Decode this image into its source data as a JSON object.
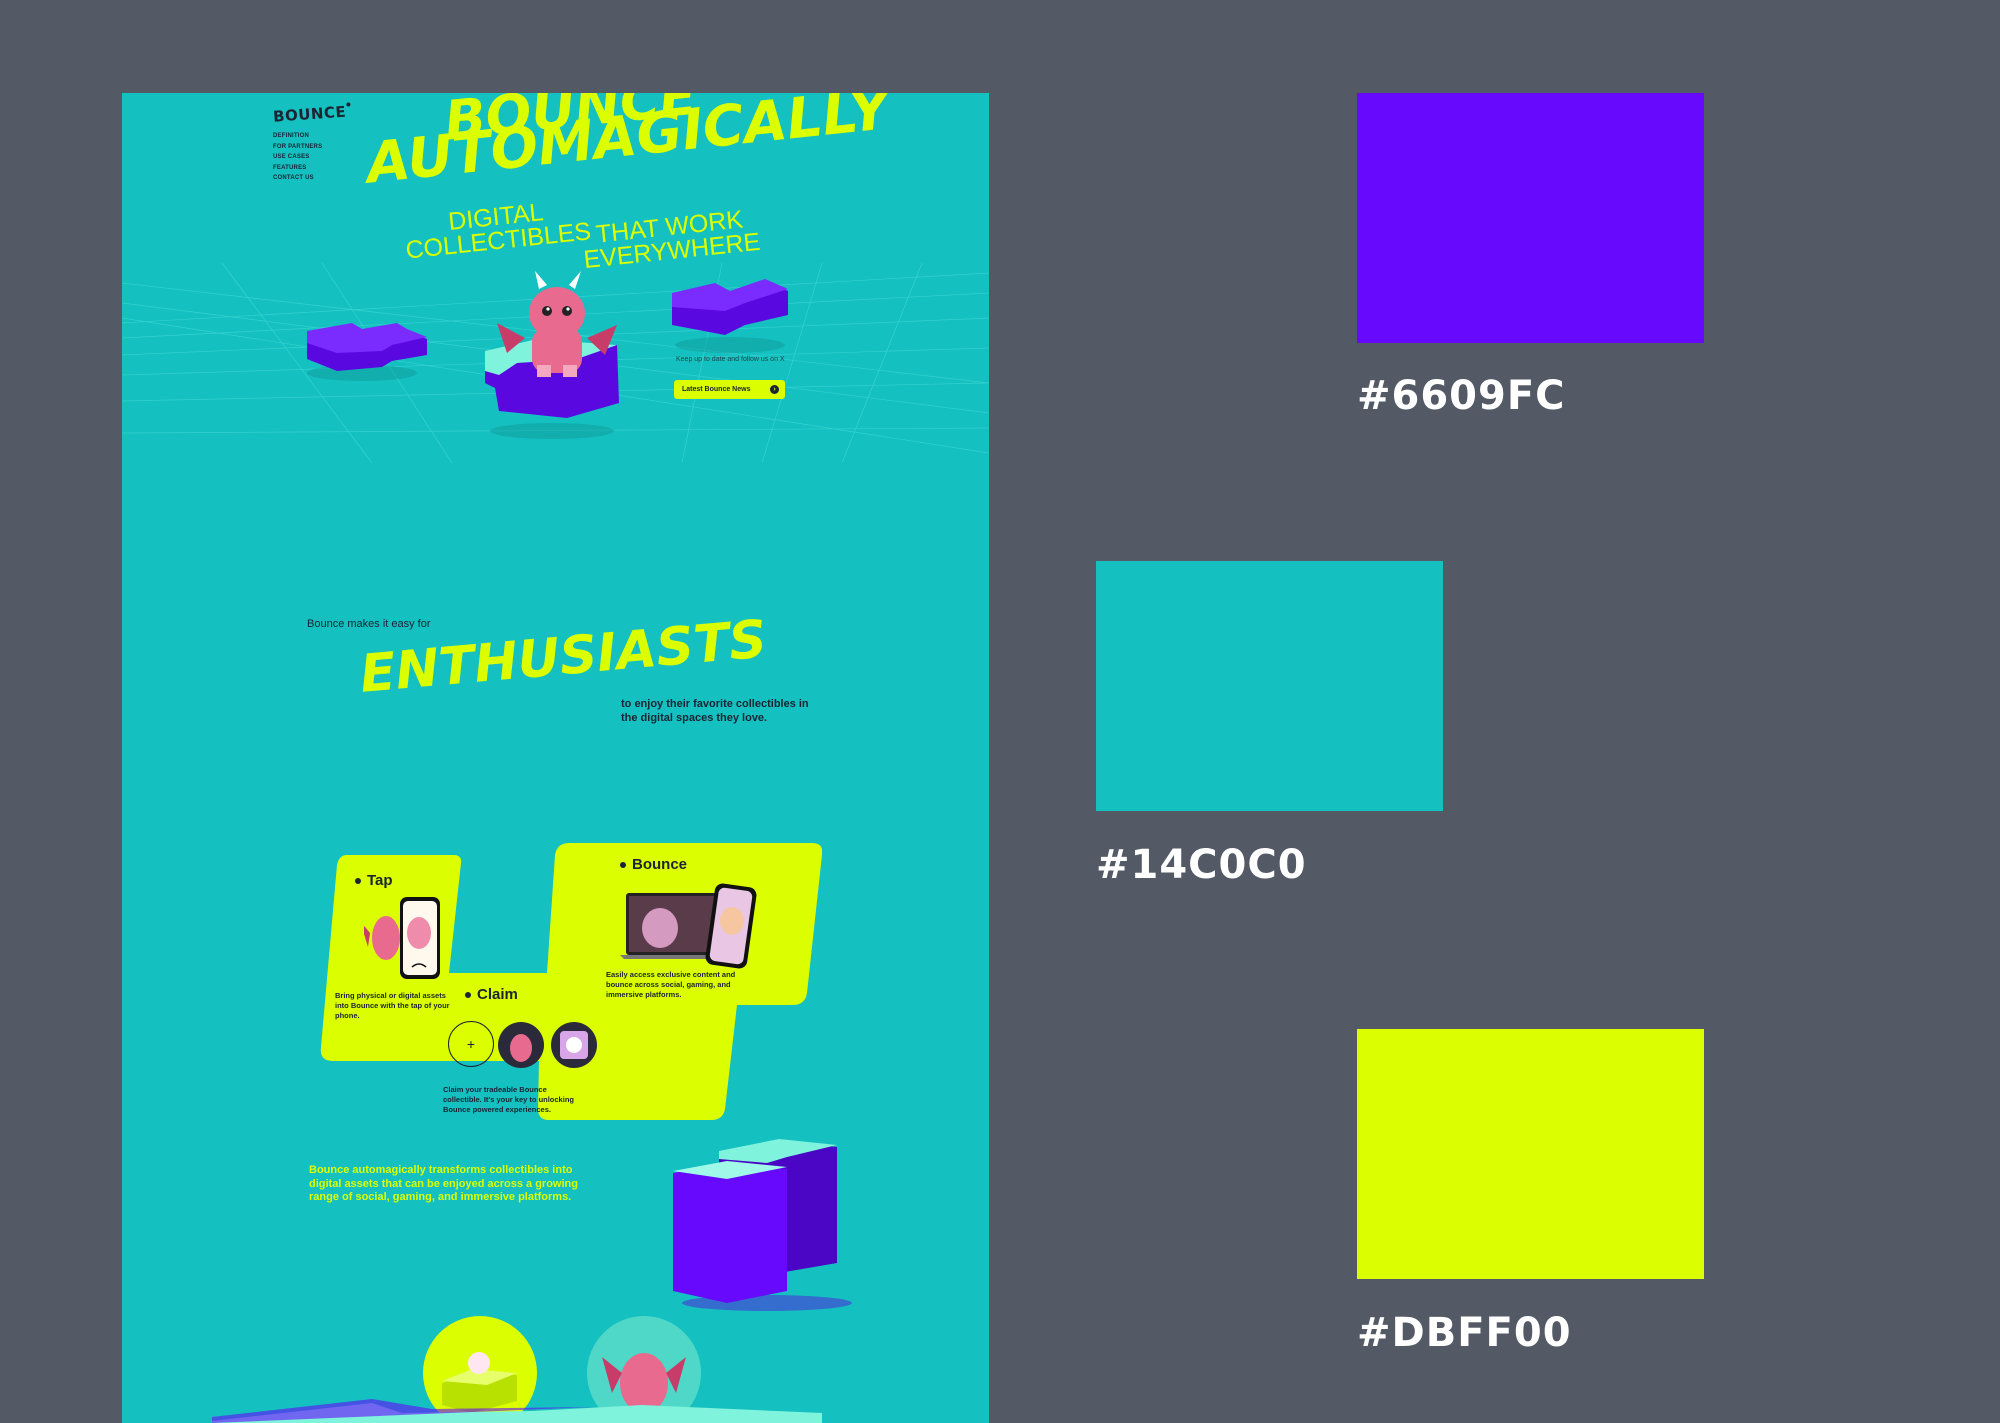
{
  "site": {
    "logo": "BOUNCE",
    "nav": [
      "DEFINITION",
      "FOR PARTNERS",
      "USE CASES",
      "FEATURES",
      "CONTACT US"
    ],
    "hero": {
      "line1": "BOUNCE",
      "line2": "AUTOMAGICALLY",
      "sub_left_1": "DIGITAL",
      "sub_left_2": "COLLECTIBLES",
      "sub_right_1": "THAT WORK",
      "sub_right_2": "EVERYWHERE"
    },
    "news": {
      "text": "Keep up to date and follow us on X",
      "button": "Latest Bounce News"
    },
    "audience": {
      "intro": "Bounce makes it easy for",
      "headline": "ENTHUSIASTS",
      "outro": "to enjoy their favorite collectibles in the digital spaces they love."
    },
    "features": {
      "tap": {
        "title": "Tap",
        "desc": "Bring physical or digital assets into Bounce with the tap of your phone."
      },
      "claim": {
        "title": "Claim",
        "add_symbol": "+",
        "desc": "Claim your tradeable Bounce collectible. It's your key to unlocking Bounce powered experiences."
      },
      "bounce": {
        "title": "Bounce",
        "desc": "Easily access exclusive content and bounce across social, gaming, and immersive platforms."
      }
    },
    "transform_text": "Bounce automagically transforms collectibles into digital assets that can be enjoyed across a growing range of social, gaming, and immersive platforms."
  },
  "palette": [
    {
      "label": "#6609FC",
      "color": "#6609FC"
    },
    {
      "label": "#14C0C0",
      "color": "#14C0C0"
    },
    {
      "label": "#DBFF00",
      "color": "#DBFF00"
    }
  ],
  "colors": {
    "page_bg": "#535a66",
    "text_dark": "#1b2433",
    "dragon_pink": "#e86a8e",
    "mint": "#7ff3dc"
  }
}
